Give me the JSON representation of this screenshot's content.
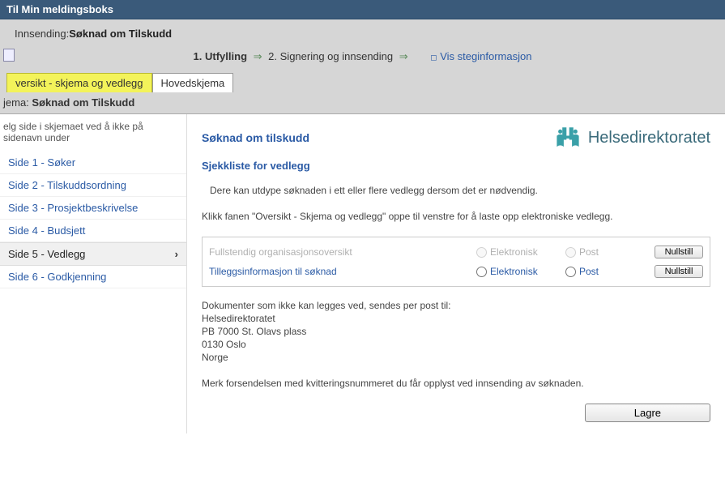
{
  "topbar": {
    "title": "Til Min meldingsboks"
  },
  "header": {
    "submission_label": "Innsending:",
    "submission_value": "Søknad om Tilskudd",
    "steps": {
      "step1_num": "1.",
      "step1_label": "Utfylling",
      "step2_num": "2.",
      "step2_label": "Signering og innsending",
      "info_link": "Vis steginformasjon"
    },
    "tabs": {
      "overview": "versikt - skjema og vedlegg",
      "mainform": "Hovedskjema"
    }
  },
  "sidebar": {
    "schema_lead": "jema:",
    "schema_value": "Søknad om Tilskudd",
    "instruction": "elg side i skjemaet ved å ikke på sidenavn under",
    "items": [
      {
        "label": "Side 1 - Søker"
      },
      {
        "label": "Side 2 - Tilskuddsordning"
      },
      {
        "label": "Side 3 - Prosjektbeskrivelse"
      },
      {
        "label": "Side 4 - Budsjett"
      },
      {
        "label": "Side 5 - Vedlegg"
      },
      {
        "label": "Side 6 - Godkjenning"
      }
    ]
  },
  "main": {
    "title": "Søknad om tilskudd",
    "logo_text": "Helsedirektoratet",
    "checklist_heading": "Sjekkliste for vedlegg",
    "desc1": "Dere kan utdype søknaden i ett eller flere vedlegg dersom det er nødvendig.",
    "desc2": "Klikk fanen \"Oversikt - Skjema og vedlegg\" oppe til venstre for å laste opp elektroniske vedlegg.",
    "rows": [
      {
        "name": "Fullstendig organisasjonsoversikt",
        "elek": "Elektronisk",
        "post": "Post",
        "reset": "Nullstill"
      },
      {
        "name": "Tilleggsinformasjon til søknad",
        "elek": "Elektronisk",
        "post": "Post",
        "reset": "Nullstill"
      }
    ],
    "address_intro": "Dokumenter som ikke kan legges ved, sendes per post til:",
    "address": {
      "l1": "Helsedirektoratet",
      "l2": "PB 7000 St. Olavs plass",
      "l3": "0130 Oslo",
      "l4": "Norge"
    },
    "note": "Merk forsendelsen med kvitteringsnummeret du får opplyst ved innsending av søknaden.",
    "save_label": "Lagre"
  }
}
